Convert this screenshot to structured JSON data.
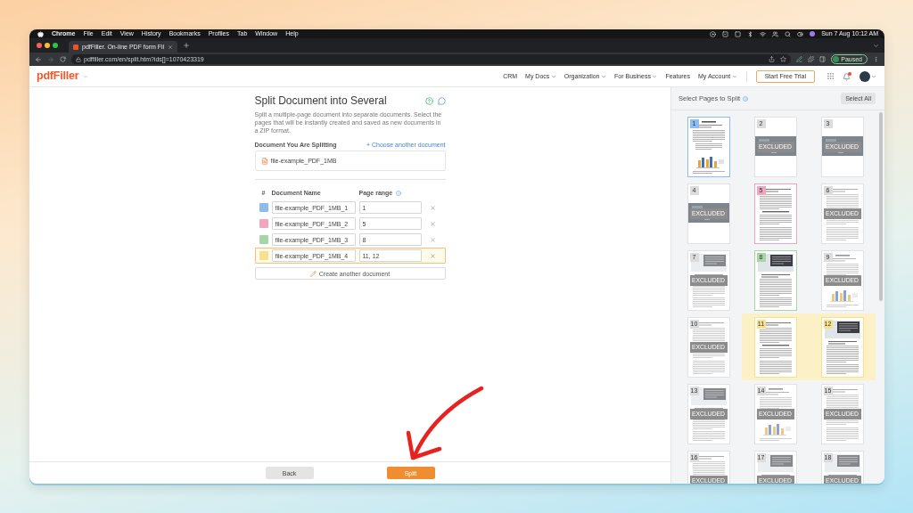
{
  "menubar": {
    "app": "Chrome",
    "items": [
      "File",
      "Edit",
      "View",
      "History",
      "Bookmarks",
      "Profiles",
      "Tab",
      "Window",
      "Help"
    ],
    "clock": "Sun 7 Aug 10:12 AM"
  },
  "browser": {
    "tab_title": "pdfFiller. On-line PDF form Fil",
    "url": "pdffiller.com/en/split.htm?ids[]=1070423319",
    "profile_status": "Paused"
  },
  "header": {
    "logo": "pdfFiller",
    "nav": [
      {
        "label": "CRM",
        "dropdown": false
      },
      {
        "label": "My Docs",
        "dropdown": true
      },
      {
        "label": "Organization",
        "dropdown": true
      },
      {
        "label": "For Business",
        "dropdown": true
      },
      {
        "label": "Features",
        "dropdown": false
      },
      {
        "label": "My Account",
        "dropdown": true
      }
    ],
    "trial_button": "Start Free Trial"
  },
  "form": {
    "title": "Split Document into Several",
    "description": "Split a multiple-page document into separate documents. Select the pages that will be instantly created and saved as new documents in a ZIP format.",
    "source_label": "Document You Are Splitting",
    "choose_link": "+ Choose another document",
    "file_name": "file-example_PDF_1MB",
    "columns": [
      "#",
      "Document Name",
      "Page range"
    ],
    "documents": [
      {
        "name": "file-example_PDF_1MB_1",
        "range": "1",
        "color": "#8cbcf0",
        "selected": false
      },
      {
        "name": "file-example_PDF_1MB_2",
        "range": "5",
        "color": "#f0a6bd",
        "selected": false
      },
      {
        "name": "file-example_PDF_1MB_3",
        "range": "8",
        "color": "#a6d5a6",
        "selected": false
      },
      {
        "name": "file-example_PDF_1MB_4",
        "range": "11, 12",
        "color": "#f7e08e",
        "selected": true
      }
    ],
    "create_button": "Create another document"
  },
  "pages_panel": {
    "title": "Select Pages to Split",
    "select_all": "Select All",
    "pages": [
      {
        "number": "1",
        "kind": "chart",
        "excluded": false,
        "color": "#8cbcf0",
        "highlighted": false
      },
      {
        "number": "2",
        "kind": "photo",
        "excluded": true,
        "label": "EXCLUDED",
        "highlighted": false
      },
      {
        "number": "3",
        "kind": "photo",
        "excluded": true,
        "label": "EXCLUDED",
        "highlighted": false
      },
      {
        "number": "4",
        "kind": "photo",
        "excluded": true,
        "label": "EXCLUDED",
        "highlighted": false
      },
      {
        "number": "5",
        "kind": "text",
        "excluded": false,
        "color": "#f0a6bd",
        "highlighted": false
      },
      {
        "number": "6",
        "kind": "text",
        "excluded": true,
        "label": "EXCLUDED",
        "highlighted": false
      },
      {
        "number": "7",
        "kind": "image-text",
        "excluded": true,
        "label": "EXCLUDED",
        "highlighted": false
      },
      {
        "number": "8",
        "kind": "image-text",
        "excluded": false,
        "color": "#a6d5a6",
        "highlighted": false
      },
      {
        "number": "9",
        "kind": "chart",
        "excluded": true,
        "label": "EXCLUDED",
        "highlighted": false
      },
      {
        "number": "10",
        "kind": "text",
        "excluded": true,
        "label": "EXCLUDED",
        "highlighted": false
      },
      {
        "number": "11",
        "kind": "text",
        "excluded": false,
        "color": "#f7e08e",
        "highlighted": true
      },
      {
        "number": "12",
        "kind": "image-text",
        "excluded": false,
        "color": "#f7e08e",
        "highlighted": true
      },
      {
        "number": "13",
        "kind": "image-text",
        "excluded": true,
        "label": "EXCLUDED",
        "highlighted": false
      },
      {
        "number": "14",
        "kind": "chart",
        "excluded": true,
        "label": "EXCLUDED",
        "highlighted": false
      },
      {
        "number": "15",
        "kind": "text",
        "excluded": true,
        "label": "EXCLUDED",
        "highlighted": false
      },
      {
        "number": "16",
        "kind": "text",
        "excluded": true,
        "label": "EXCLUDED",
        "highlighted": false
      },
      {
        "number": "17",
        "kind": "image-text",
        "excluded": true,
        "label": "EXCLUDED",
        "highlighted": false
      },
      {
        "number": "18",
        "kind": "image-text",
        "excluded": true,
        "label": "EXCLUDED",
        "highlighted": false
      }
    ]
  },
  "footer": {
    "back": "Back",
    "split": "Split"
  }
}
